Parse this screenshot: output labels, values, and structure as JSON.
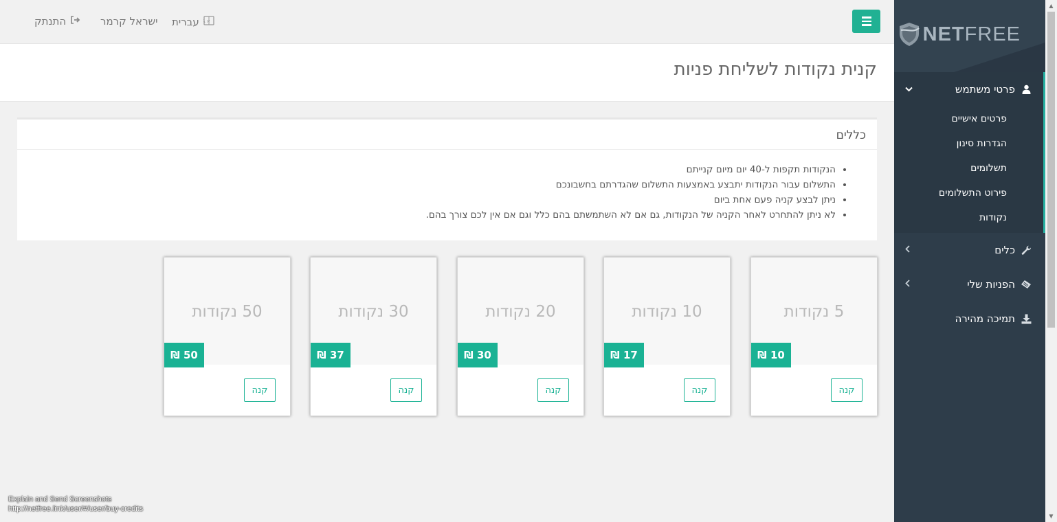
{
  "topbar": {
    "menu_label": "",
    "language": "עברית",
    "user_name": "ישראל קרמר",
    "logout": "התנתק"
  },
  "page": {
    "title": "קנית נקודות לשליחת פניות"
  },
  "rules": {
    "heading": "כללים",
    "items": [
      "הנקודות תקפות ל-40 יום מיום קנייתם",
      "התשלום עבור הנקודות יתבצע באמצעות התשלום שהגדרתם בחשבונכם",
      "ניתן לבצע קניה פעם אחת ביום",
      "לא ניתן להתחרט לאחר הקניה של הנקודות, גם אם לא השתמשתם בהם כלל וגם אם אין לכם צורך בהם."
    ]
  },
  "cards": [
    {
      "amount": "5 נקודות",
      "price": "10 ₪",
      "buy_label": "קנה"
    },
    {
      "amount": "10 נקודות",
      "price": "17 ₪",
      "buy_label": "קנה"
    },
    {
      "amount": "20 נקודות",
      "price": "30 ₪",
      "buy_label": "קנה"
    },
    {
      "amount": "30 נקודות",
      "price": "37 ₪",
      "buy_label": "קנה"
    },
    {
      "amount": "50 נקודות",
      "price": "50 ₪",
      "buy_label": "קנה"
    }
  ],
  "sidebar": {
    "brand_bold": "NET",
    "brand_light": "FREE",
    "groups": [
      {
        "label": "פרטי משתמש",
        "icon": "user-icon",
        "open": true,
        "sub_items": [
          "פרטים אישיים",
          "הגדרות סינון",
          "תשלומים",
          "פירוט התשלומים",
          "נקודות"
        ]
      },
      {
        "label": "כלים",
        "icon": "wrench-icon"
      },
      {
        "label": "הפניות שלי",
        "icon": "ticket-icon"
      },
      {
        "label": "תמיכה מהירה",
        "icon": "download-icon"
      }
    ]
  },
  "status_bar": {
    "line1": "Explain and Send Screenshots",
    "line2": "http://netfree.link/user/#/user/buy-credits"
  },
  "colors": {
    "accent": "#1ab294",
    "sidebar_bg": "#2e3d4a",
    "active_border": "#25b0a1"
  }
}
